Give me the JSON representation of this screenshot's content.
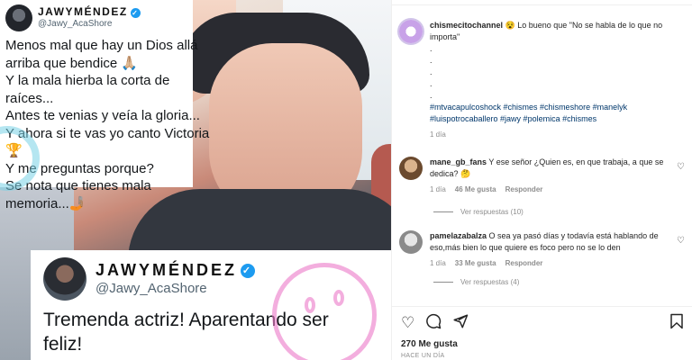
{
  "tweet_top": {
    "name": "JAWYMÉNDEZ",
    "handle": "@Jawy_AcaShore",
    "lines": [
      "Menos mal que hay un Dios allá",
      "arriba que bendice 🙏🏼",
      "Y la mala hierba la corta de",
      "raíces...",
      "Antes te venias y veía la gloria...",
      "Y ahora si te vas yo canto Victoria",
      "🏆",
      "Y me preguntas porque?",
      "Se nota que tienes mala",
      "memoria...🤳🏽"
    ]
  },
  "tweet_bottom": {
    "name": "JAWYMÉNDEZ",
    "handle": "@Jawy_AcaShore",
    "text": "Tremenda actriz! Aparentando ser feliz!"
  },
  "caption": {
    "username": "chismecitochannel",
    "text": "😵 Lo bueno que \"No se habla de lo que no importa\"",
    "dots": [
      ".",
      ".",
      ".",
      ".",
      "."
    ],
    "hashtags": "#mtvacapulcoshock #chismes #chismeshore #manelyk #luispotrocaballero #jawy #polemica #chismes",
    "time": "1 día"
  },
  "comments": [
    {
      "username": "mane_gb_fans",
      "text": "Y ese señor ¿Quien es, en que trabaja, a que se dedica? 🤔",
      "time": "1 día",
      "likes": "46 Me gusta",
      "reply": "Responder",
      "view_replies": "Ver respuestas (10)"
    },
    {
      "username": "pamelazabalza",
      "text": "O sea ya pasó días y todavía está hablando de eso,más bien lo que quiere es foco pero no se lo den",
      "time": "1 día",
      "likes": "33 Me gusta",
      "reply": "Responder",
      "view_replies": "Ver respuestas (4)"
    }
  ],
  "actions": {
    "likes": "270 Me gusta",
    "posted": "HACE UN DÍA",
    "icons": [
      "heart-icon",
      "comment-icon",
      "share-icon",
      "bookmark-icon"
    ]
  }
}
